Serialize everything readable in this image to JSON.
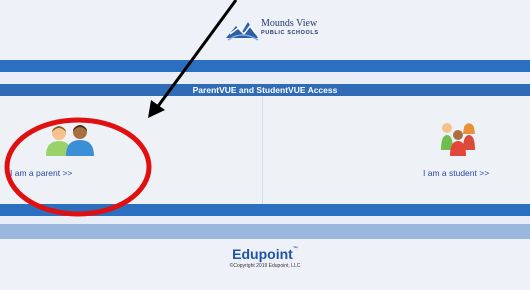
{
  "header": {
    "logo_name": "Mounds View",
    "logo_tag": "PUBLIC SCHOOLS"
  },
  "access": {
    "title": "ParentVUE and StudentVUE Access",
    "parent_label": "I am a parent >>",
    "student_label": "I am a student >>"
  },
  "footer": {
    "brand": "Edupoint",
    "trademark": "™",
    "copyright": "©Copyright 2019 Edupoint, LLC"
  },
  "annotations": {
    "arrow_color": "#000000",
    "circle_color": "#e01010"
  },
  "colors": {
    "bar_dark": "#2a6fc0",
    "bar_light": "#9ab8dd",
    "link": "#2a46a4"
  }
}
